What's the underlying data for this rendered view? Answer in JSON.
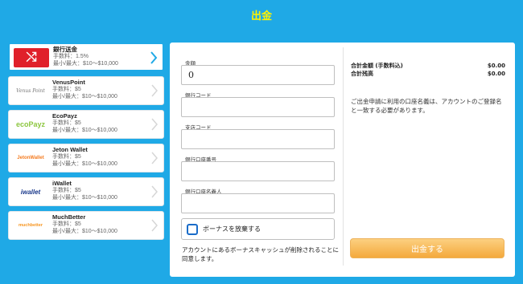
{
  "page_title": "出金",
  "methods": [
    {
      "name": "銀行送金",
      "fee": "手数料：1.5%",
      "limits": "最小/最大：$10～$10,000",
      "logo_text": "⤭",
      "active": true
    },
    {
      "name": "VenusPoint",
      "fee": "手数料：$5",
      "limits": "最小/最大：$10～$10,000",
      "logo_text": "Venus Point",
      "active": false
    },
    {
      "name": "EcoPayz",
      "fee": "手数料：$5",
      "limits": "最小/最大：$10～$10,000",
      "logo_text": "ecoPayz",
      "active": false
    },
    {
      "name": "Jeton Wallet",
      "fee": "手数料：$5",
      "limits": "最小/最大：$10～$10,000",
      "logo_text": "JetonWallet",
      "active": false
    },
    {
      "name": "iWallet",
      "fee": "手数料：$5",
      "limits": "最小/最大：$10～$10,000",
      "logo_text": "iwallet",
      "active": false
    },
    {
      "name": "MuchBetter",
      "fee": "手数料：$5",
      "limits": "最小/最大：$10～$10,000",
      "logo_text": "muchbetter",
      "active": false
    }
  ],
  "form": {
    "amount_label": "金額",
    "amount_value": "0",
    "bank_code_label": "銀行コード",
    "branch_code_label": "支店コード",
    "account_number_label": "銀行口座番号",
    "account_name_label": "銀行口座名義人",
    "bonus_label": "ボーナスを放棄する",
    "note": "アカウントにあるボーナスキャッシュが削除されることに同意します。"
  },
  "summary": {
    "total_amount_label": "合計金額 (手数料込)",
    "total_amount_value": "$0.00",
    "total_balance_label": "合計残高",
    "total_balance_value": "$0.00",
    "note": "ご出金申請に利用の口座名義は、アカウントのご登録名と一致する必要があります。"
  },
  "submit_label": "出金する",
  "colors": {
    "background": "#1fa9e6",
    "title": "#fff200",
    "accent_red": "#e0202a",
    "submit": "#f4a93c"
  }
}
